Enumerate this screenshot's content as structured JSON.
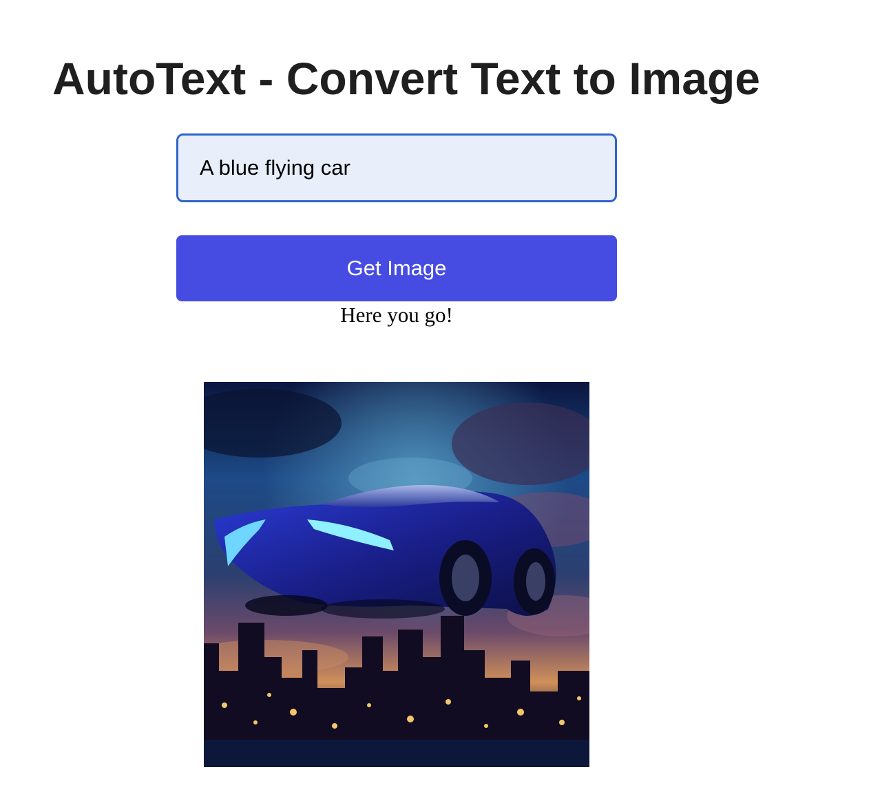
{
  "header": {
    "title": "AutoText - Convert Text to Image"
  },
  "form": {
    "prompt_value": "A blue flying car",
    "submit_label": "Get Image"
  },
  "result": {
    "status_text": "Here you go!"
  }
}
